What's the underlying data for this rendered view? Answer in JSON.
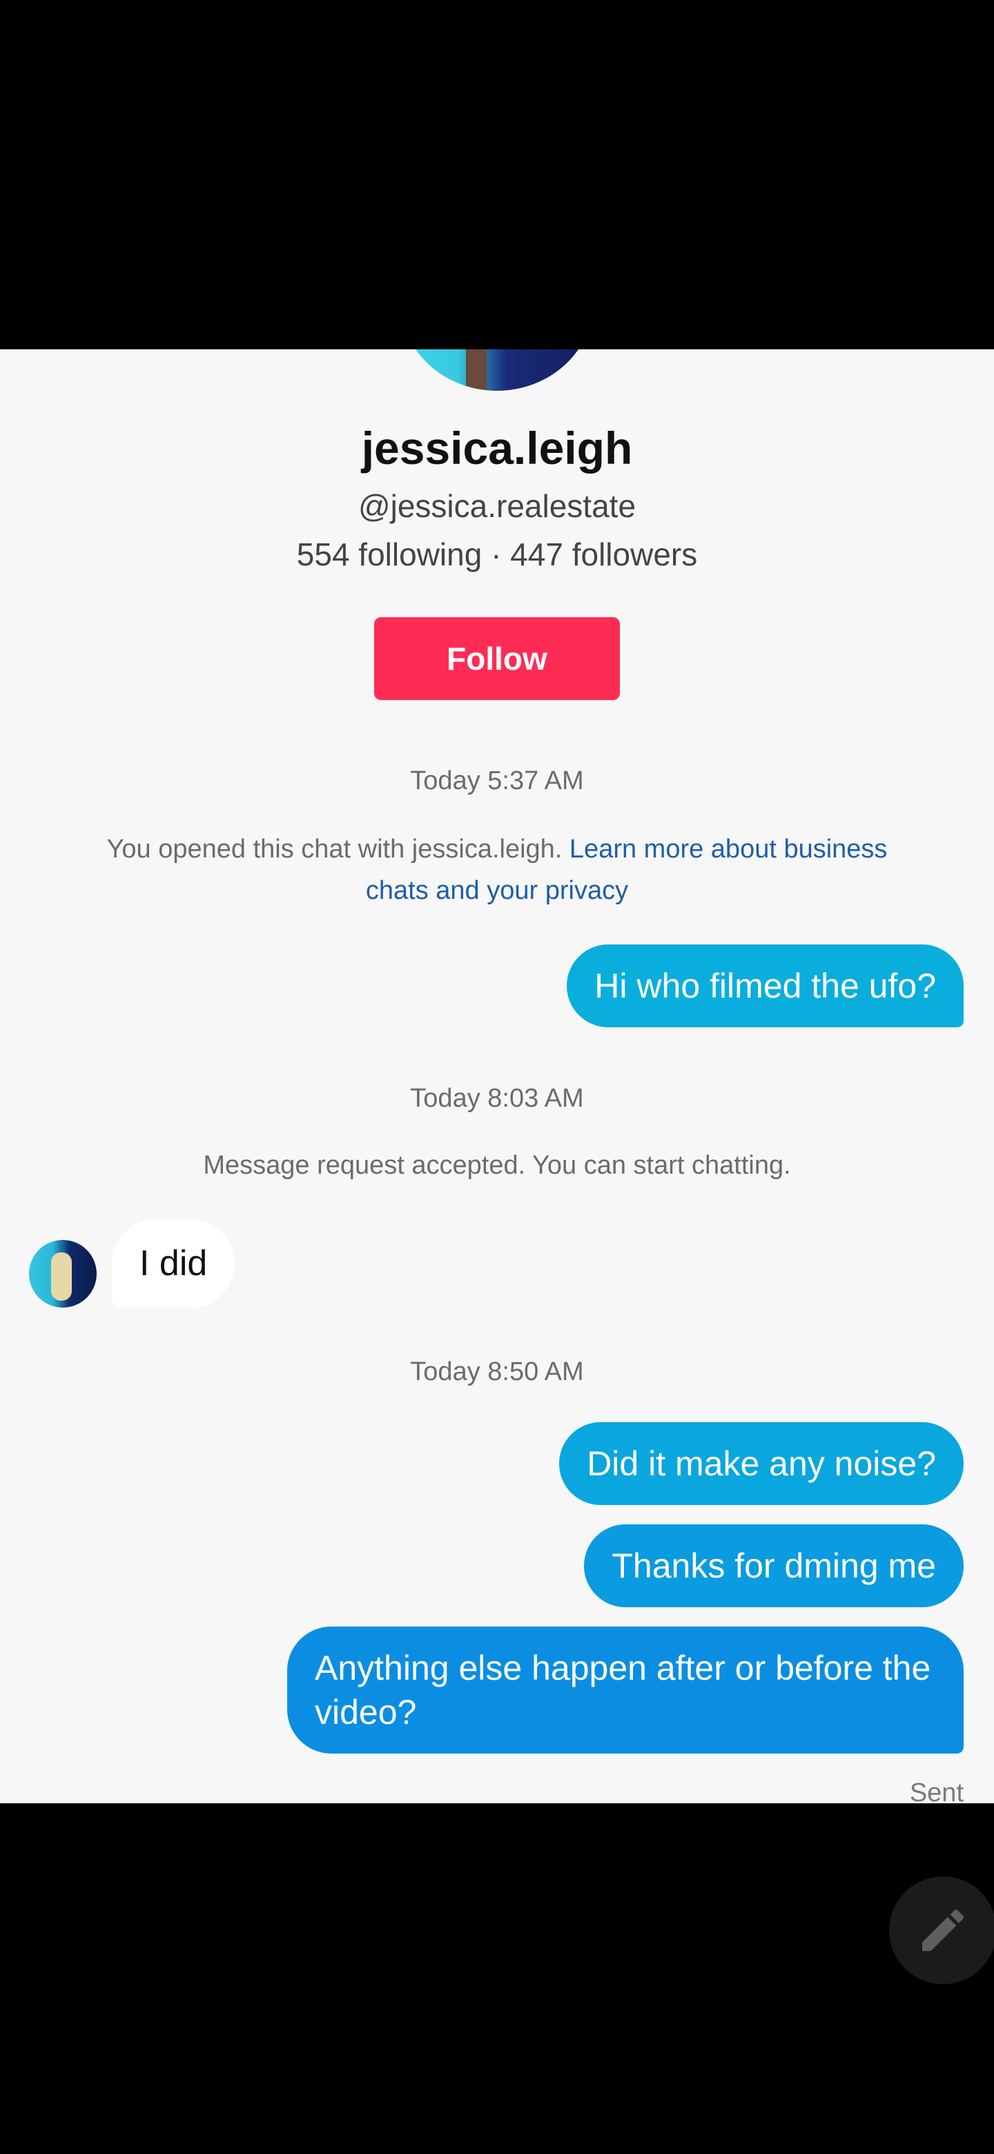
{
  "profile": {
    "display_name": "jessica.leigh",
    "handle": "@jessica.realestate",
    "stats": "554 following · 447 followers",
    "follow_label": "Follow"
  },
  "chat": {
    "timestamp_1": "Today 5:37 AM",
    "system_opened_text": "You opened this chat with jessica.leigh.",
    "system_opened_link": "Learn more about business chats and your privacy",
    "msg_out_1": "Hi who filmed the ufo?",
    "timestamp_2": "Today 8:03 AM",
    "system_accepted": "Message request accepted. You can start chatting.",
    "msg_in_1": "I did",
    "timestamp_3": "Today 8:50 AM",
    "msg_out_2": "Did it make any noise?",
    "msg_out_3": "Thanks for dming me",
    "msg_out_4": "Anything else happen after or before the video?",
    "status": "Sent"
  },
  "icons": {
    "compose": "pencil-icon"
  },
  "colors": {
    "follow": "#fe2c55",
    "outgoing_bubble": "#0aa6de",
    "link": "#1f5ea8"
  }
}
